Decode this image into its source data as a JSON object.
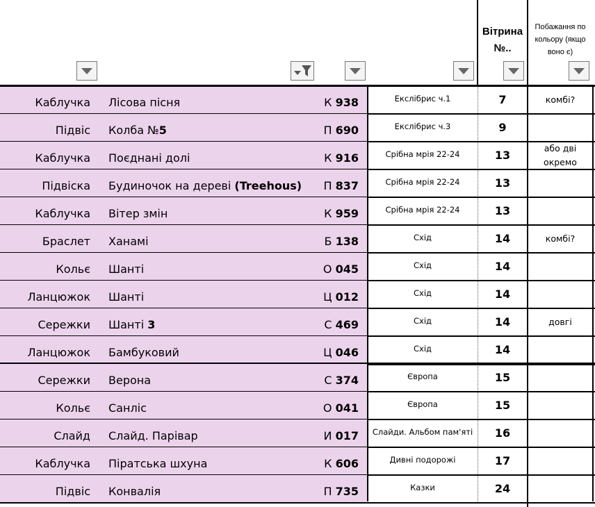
{
  "header": {
    "vitryna": "Вітрина №..",
    "wish": "Побажання по кольору (якщо воно є)",
    "filters": [
      {
        "name": "filter-type",
        "active": false
      },
      {
        "name": "filter-name",
        "active": true
      },
      {
        "name": "filter-code",
        "active": false
      },
      {
        "name": "filter-collection",
        "active": false
      },
      {
        "name": "filter-vitryna",
        "active": false
      },
      {
        "name": "filter-wish",
        "active": false
      }
    ]
  },
  "rows": [
    {
      "type": "Каблучка",
      "name": "Лісова пісня",
      "code_prefix": "К",
      "code_num": "938",
      "collection": "Екслібрис ч.1",
      "vitryna": "7",
      "wish": "комбі?"
    },
    {
      "type": "Підвіс",
      "name": "Колба №5",
      "code_prefix": "П",
      "code_num": "690",
      "collection": "Екслібрис ч.3",
      "vitryna": "9",
      "wish": ""
    },
    {
      "type": "Каблучка",
      "name": "Поєднані долі",
      "code_prefix": "К",
      "code_num": "916",
      "collection": "Срібна мрія 22-24",
      "vitryna": "13",
      "wish": "або дві окремо"
    },
    {
      "type": "Підвіска",
      "name": "Будиночок на дереві (Treehous)",
      "code_prefix": "П",
      "code_num": "837",
      "collection": "Срібна мрія 22-24",
      "vitryna": "13",
      "wish": ""
    },
    {
      "type": "Каблучка",
      "name": "Вітер змін",
      "code_prefix": "К",
      "code_num": "959",
      "collection": "Срібна мрія 22-24",
      "vitryna": "13",
      "wish": ""
    },
    {
      "type": "Браслет",
      "name": "Ханамі",
      "code_prefix": "Б",
      "code_num": "138",
      "collection": "Схід",
      "vitryna": "14",
      "wish": "комбі?"
    },
    {
      "type": "Кольє",
      "name": "Шанті",
      "code_prefix": "О",
      "code_num": "045",
      "collection": "Схід",
      "vitryna": "14",
      "wish": ""
    },
    {
      "type": "Ланцюжок",
      "name": "Шанті",
      "code_prefix": "Ц",
      "code_num": "012",
      "collection": "Схід",
      "vitryna": "14",
      "wish": ""
    },
    {
      "type": "Сережки",
      "name": "Шанті 3",
      "code_prefix": "С",
      "code_num": "469",
      "collection": "Схід",
      "vitryna": "14",
      "wish": "довгі"
    },
    {
      "type": "Ланцюжок",
      "name": "Бамбуковий",
      "code_prefix": "Ц",
      "code_num": "046",
      "collection": "Схід",
      "vitryna": "14",
      "wish": ""
    },
    {
      "type": "Сережки",
      "name": "Верона",
      "code_prefix": "С",
      "code_num": "374",
      "collection": "Європа",
      "vitryna": "15",
      "wish": ""
    },
    {
      "type": "Кольє",
      "name": "Санліс",
      "code_prefix": "О",
      "code_num": "041",
      "collection": "Європа",
      "vitryna": "15",
      "wish": ""
    },
    {
      "type": "Слайд",
      "name": "Слайд. Парівар",
      "code_prefix": "И",
      "code_num": "017",
      "collection": "Слайди. Альбом пам'яті",
      "vitryna": "16",
      "wish": ""
    },
    {
      "type": "Каблучка",
      "name": "Піратська шхуна",
      "code_prefix": "К",
      "code_num": "606",
      "collection": "Дивні подорожі",
      "vitryna": "17",
      "wish": ""
    },
    {
      "type": "Підвіс",
      "name": "Конвалія",
      "code_prefix": "П",
      "code_num": "735",
      "collection": "Казки",
      "vitryna": "24",
      "wish": ""
    }
  ]
}
